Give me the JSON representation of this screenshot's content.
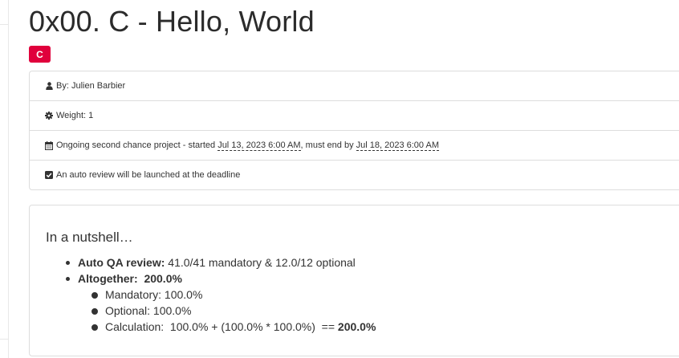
{
  "page": {
    "title": "0x00. C - Hello, World",
    "badge": "C"
  },
  "meta": {
    "author": "By: Julien Barbier",
    "weight": "Weight: 1",
    "schedule_prefix": "Ongoing second chance project - started ",
    "start_date": "Jul 13, 2023 6:00 AM",
    "schedule_middle": ", must end by ",
    "end_date": "Jul 18, 2023 6:00 AM",
    "auto_review": "An auto review will be launched at the deadline"
  },
  "summary": {
    "title": "In a nutshell…",
    "qa_label": "Auto QA review:",
    "qa_value": " 41.0/41 mandatory & 12.0/12 optional",
    "altogether_label": "Altogether:",
    "altogether_value": "200.0%",
    "mandatory": "Mandatory: 100.0%",
    "optional": "Optional: 100.0%",
    "calculation_text": "Calculation:  100.0% + (100.0% * 100.0%)  == ",
    "calculation_result": "200.0%"
  },
  "colors": {
    "badge": "#e0003c",
    "text": "#333333",
    "border": "#dddddd"
  },
  "icons": {
    "author": "user-icon",
    "weight": "cog-icon",
    "schedule": "calendar-icon",
    "auto_review": "checkbox-checked-icon"
  }
}
